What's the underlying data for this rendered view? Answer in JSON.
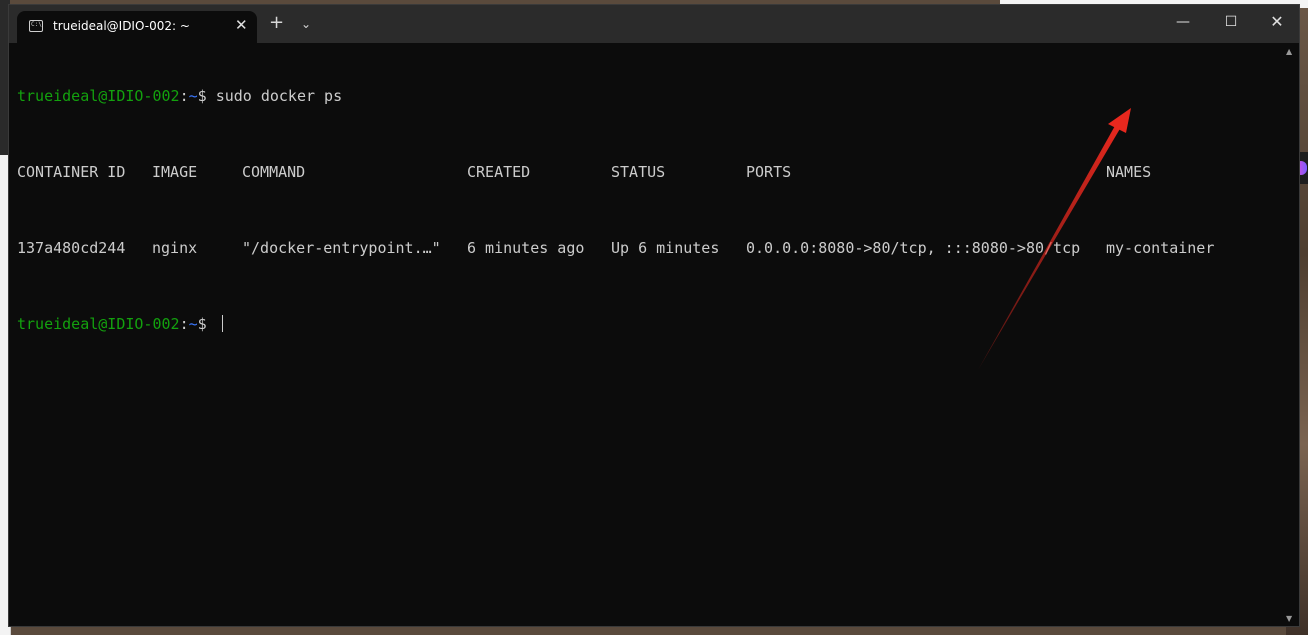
{
  "window": {
    "tab_title": "trueideal@IDIO-002: ~",
    "close_tab_glyph": "✕",
    "new_tab_glyph": "+",
    "dropdown_glyph": "⌄",
    "minimize_glyph": "—",
    "maximize_glyph": "☐",
    "close_glyph": "✕"
  },
  "terminal": {
    "prompt_user": "trueideal@IDIO-002",
    "prompt_sep": ":",
    "prompt_path": "~",
    "prompt_symbol": "$ ",
    "command": "sudo docker ps",
    "headers": [
      "CONTAINER ID",
      "IMAGE",
      "COMMAND",
      "CREATED",
      "STATUS",
      "PORTS",
      "NAMES"
    ],
    "rows": [
      [
        "137a480cd244",
        "nginx",
        "\"/docker-entrypoint.…\"",
        "6 minutes ago",
        "Up 6 minutes",
        "0.0.0.0:8080->80/tcp, :::8080->80/tcp",
        "my-container"
      ]
    ]
  },
  "colors": {
    "prompt_user": "#13a10e",
    "prompt_path": "#3b78ff",
    "text": "#cccccc",
    "arrow": "#e8281e"
  },
  "icons": {
    "tab": "terminal-icon",
    "annotation": "red-arrow-icon"
  }
}
